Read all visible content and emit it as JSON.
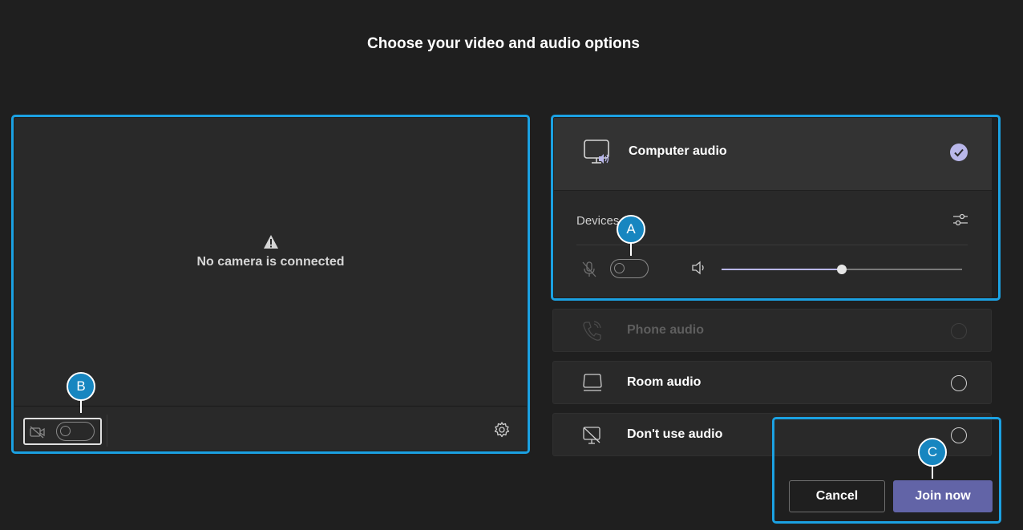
{
  "title": "Choose your video and audio options",
  "video": {
    "message": "No camera is connected",
    "camera_toggle_on": false
  },
  "audio": {
    "computer_audio_label": "Computer audio",
    "computer_audio_selected": true,
    "devices_label": "Devices",
    "mic_toggle_on": false,
    "volume_level": 0.5,
    "options": [
      {
        "label": "Phone audio",
        "enabled": false
      },
      {
        "label": "Room audio",
        "enabled": true
      },
      {
        "label": "Don't use audio",
        "enabled": true
      }
    ]
  },
  "buttons": {
    "cancel": "Cancel",
    "join": "Join now"
  },
  "markers": {
    "a": "A",
    "b": "B",
    "c": "C"
  },
  "colors": {
    "highlight": "#1ba1e2",
    "accent": "#6264a7",
    "accent_light": "#b9b7ea",
    "marker": "#1786c0"
  }
}
